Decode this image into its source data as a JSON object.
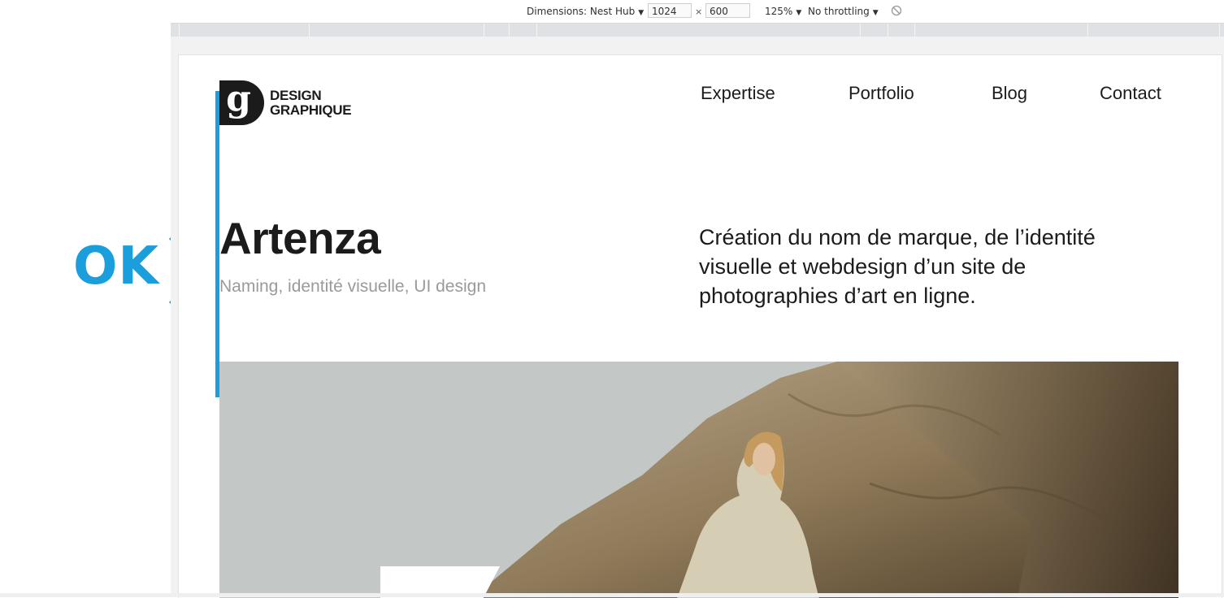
{
  "devtools": {
    "dimensions_label": "Dimensions: Nest Hub",
    "width_value": "1024",
    "separator": "×",
    "height_value": "600",
    "zoom": "125%",
    "throttling": "No throttling"
  },
  "annotation": {
    "label": "OK",
    "accent": "#1a9fdc"
  },
  "site": {
    "logo": {
      "mark": "g",
      "line1": "DESIGN",
      "line2": "GRAPHIQUE"
    },
    "nav": [
      "Expertise",
      "Portfolio",
      "Blog",
      "Contact"
    ],
    "project": {
      "title": "Artenza",
      "subtitle": "Naming, identité visuelle, UI design",
      "description": "Création du nom de marque, de l’identité visuelle et webdesign d’un site de photographies d’art en ligne."
    }
  }
}
